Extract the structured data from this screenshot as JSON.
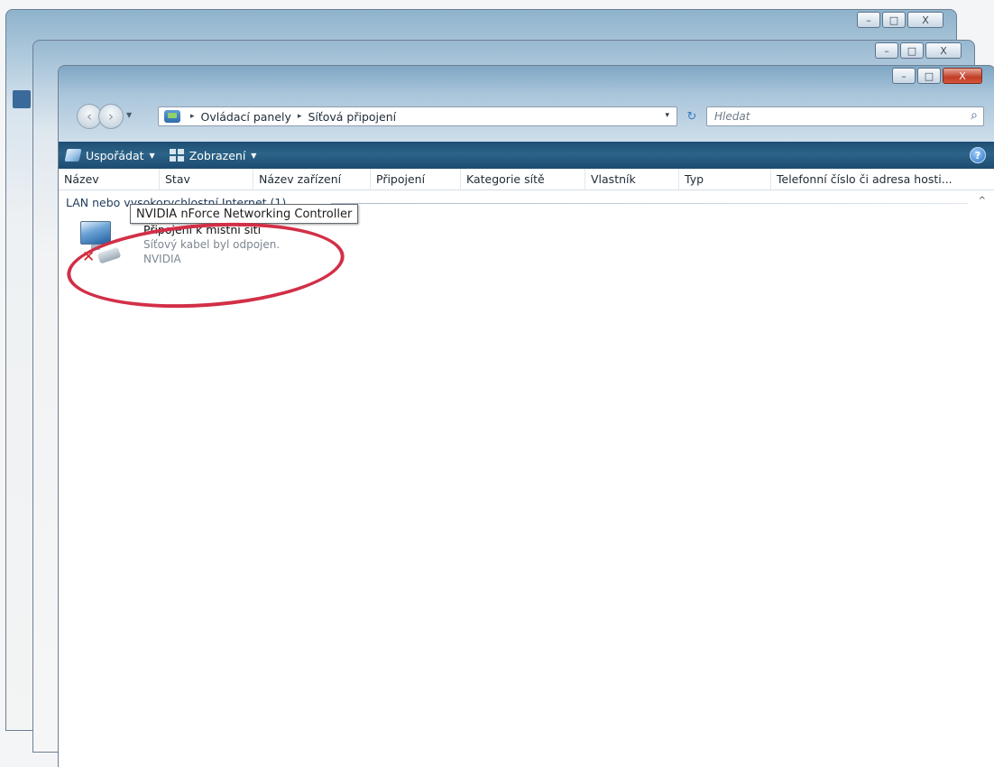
{
  "window": {
    "caption_minimize": "–",
    "caption_maximize": "□",
    "caption_close": "X"
  },
  "navigation": {
    "back_glyph": "‹",
    "forward_glyph": "›",
    "dropdown_glyph": "▼",
    "breadcrumb": [
      "Ovládací panely",
      "Síťová připojení"
    ],
    "breadcrumb_separator": "▸",
    "address_dropdown_glyph": "▾",
    "refresh_glyph": "↻",
    "search_placeholder": "Hledat",
    "search_glyph": "⌕"
  },
  "toolbar": {
    "organize_label": "Uspořádat",
    "view_label": "Zobrazení",
    "caret_glyph": "▼",
    "help_glyph": "?"
  },
  "columns": [
    "Název",
    "Stav",
    "Název zařízení",
    "Připojení",
    "Kategorie sítě",
    "Vlastník",
    "Typ",
    "Telefonní číslo či adresa hosti..."
  ],
  "group": {
    "label": "LAN nebo vysokorychlostní Internet (1)",
    "collapse_glyph": "^"
  },
  "connection": {
    "name": "Připojení k místní síti",
    "status": "Síťový kabel byl odpojen.",
    "device_short": "NVIDIA",
    "disconnected_glyph": "✕"
  },
  "tooltip": {
    "text": "NVIDIA nForce Networking Controller"
  },
  "colors": {
    "highlight": "#d22f47",
    "toolbar": "#2c6388",
    "error": "#d0262b"
  }
}
